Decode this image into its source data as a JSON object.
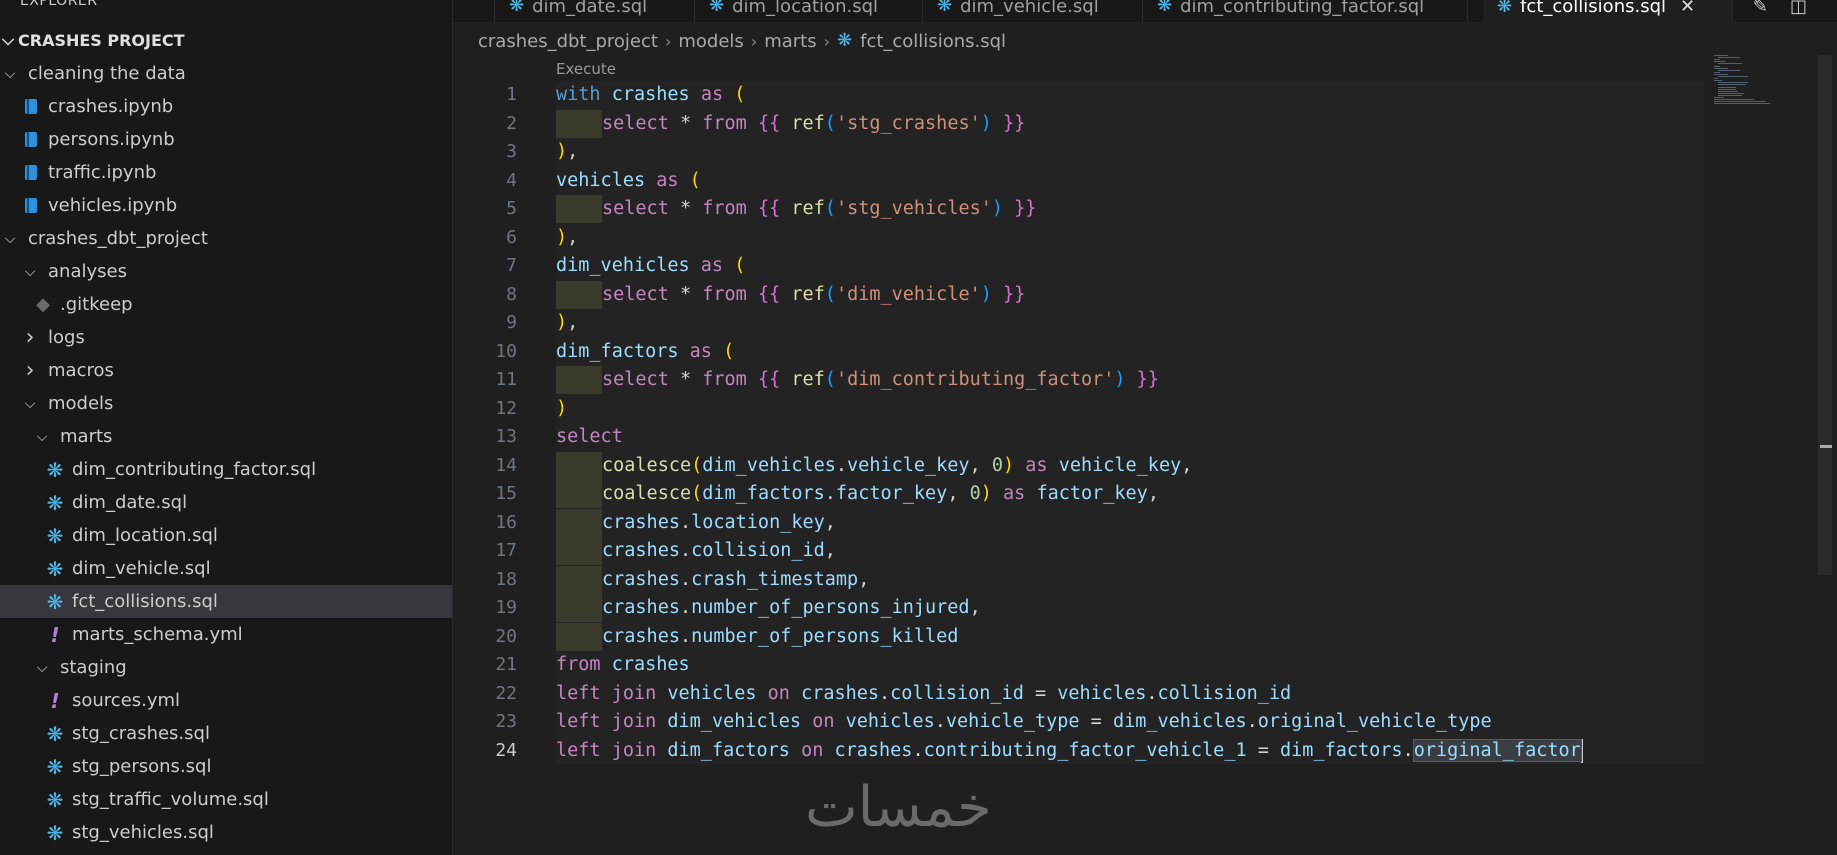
{
  "sidebar": {
    "title": "EXPLORER",
    "project": "CRASHES PROJECT",
    "items": [
      {
        "label": "cleaning the data",
        "type": "folder-open",
        "depth": 1
      },
      {
        "label": "crashes.ipynb",
        "type": "notebook",
        "depth": 2
      },
      {
        "label": "persons.ipynb",
        "type": "notebook",
        "depth": 2
      },
      {
        "label": "traffic.ipynb",
        "type": "notebook",
        "depth": 2
      },
      {
        "label": "vehicles.ipynb",
        "type": "notebook",
        "depth": 2
      },
      {
        "label": "crashes_dbt_project",
        "type": "folder-open",
        "depth": 1
      },
      {
        "label": "analyses",
        "type": "folder-open",
        "depth": 2
      },
      {
        "label": ".gitkeep",
        "type": "git",
        "depth": 3
      },
      {
        "label": "logs",
        "type": "folder-closed",
        "depth": 2
      },
      {
        "label": "macros",
        "type": "folder-closed",
        "depth": 2
      },
      {
        "label": "models",
        "type": "folder-open",
        "depth": 2
      },
      {
        "label": "marts",
        "type": "folder-open",
        "depth": 3
      },
      {
        "label": "dim_contributing_factor.sql",
        "type": "dbt",
        "depth": 4
      },
      {
        "label": "dim_date.sql",
        "type": "dbt",
        "depth": 4
      },
      {
        "label": "dim_location.sql",
        "type": "dbt",
        "depth": 4
      },
      {
        "label": "dim_vehicle.sql",
        "type": "dbt",
        "depth": 4
      },
      {
        "label": "fct_collisions.sql",
        "type": "dbt",
        "depth": 4,
        "selected": true
      },
      {
        "label": "marts_schema.yml",
        "type": "yml",
        "depth": 4
      },
      {
        "label": "staging",
        "type": "folder-open",
        "depth": 3
      },
      {
        "label": "sources.yml",
        "type": "yml",
        "depth": 4
      },
      {
        "label": "stg_crashes.sql",
        "type": "dbt",
        "depth": 4
      },
      {
        "label": "stg_persons.sql",
        "type": "dbt",
        "depth": 4
      },
      {
        "label": "stg_traffic_volume.sql",
        "type": "dbt",
        "depth": 4
      },
      {
        "label": "stg_vehicles.sql",
        "type": "dbt",
        "depth": 4
      }
    ]
  },
  "tabs": [
    {
      "label": "dim_date.sql",
      "active": false
    },
    {
      "label": "dim_location.sql",
      "active": false
    },
    {
      "label": "dim_vehicle.sql",
      "active": false
    },
    {
      "label": "dim_contributing_factor.sql",
      "active": false
    },
    {
      "label": "fct_collisions.sql",
      "active": true
    }
  ],
  "breadcrumb": [
    "crashes_dbt_project",
    "models",
    "marts",
    "fct_collisions.sql"
  ],
  "editor": {
    "codelens": "Execute",
    "current_line": 24
  },
  "icons": {
    "close": "close-icon",
    "chevron_open": "chevron-down-icon",
    "chevron_closed": "chevron-right-icon",
    "dbt": "dbt-icon",
    "notebook": "notebook-icon",
    "yml": "yml-icon",
    "git": "git-icon",
    "edit": "edit-icon",
    "split": "split-editor-icon"
  },
  "watermark": "خمسات",
  "colors": {
    "keyword": "#c586c0",
    "identifier": "#9cdcfe",
    "function": "#dcdcaa",
    "string": "#ce9178",
    "number": "#b5cea8",
    "selection": "#37373d"
  }
}
